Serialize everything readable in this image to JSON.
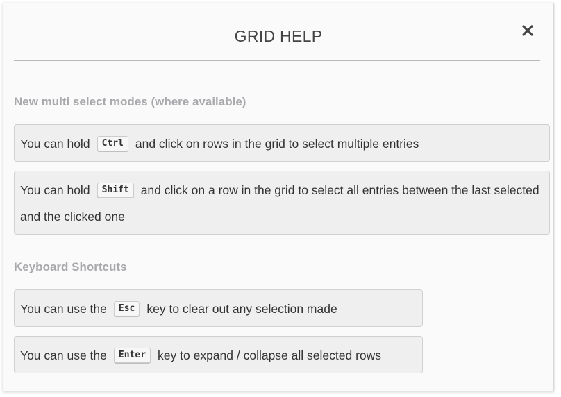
{
  "dialog": {
    "title": "GRID HELP",
    "close_icon": "close-icon"
  },
  "multi_select": {
    "heading": "New multi select modes (where available)",
    "ctrl": {
      "before": "You can hold",
      "key": "Ctrl",
      "after": "and click on rows in the grid to select multiple entries"
    },
    "shift": {
      "before": "You can hold",
      "key": "Shift",
      "after": "and click on a row in the grid to select all entries between the last selected and the clicked one"
    }
  },
  "shortcuts": {
    "heading": "Keyboard Shortcuts",
    "esc": {
      "before": "You can use the",
      "key": "Esc",
      "after": "key to clear out any selection made"
    },
    "enter": {
      "before": "You can use the",
      "key": "Enter",
      "after": "key to expand / collapse all selected rows"
    }
  },
  "colors": {
    "heading": "#a9a9ad",
    "card_bg": "#efefef",
    "text": "#333333"
  }
}
